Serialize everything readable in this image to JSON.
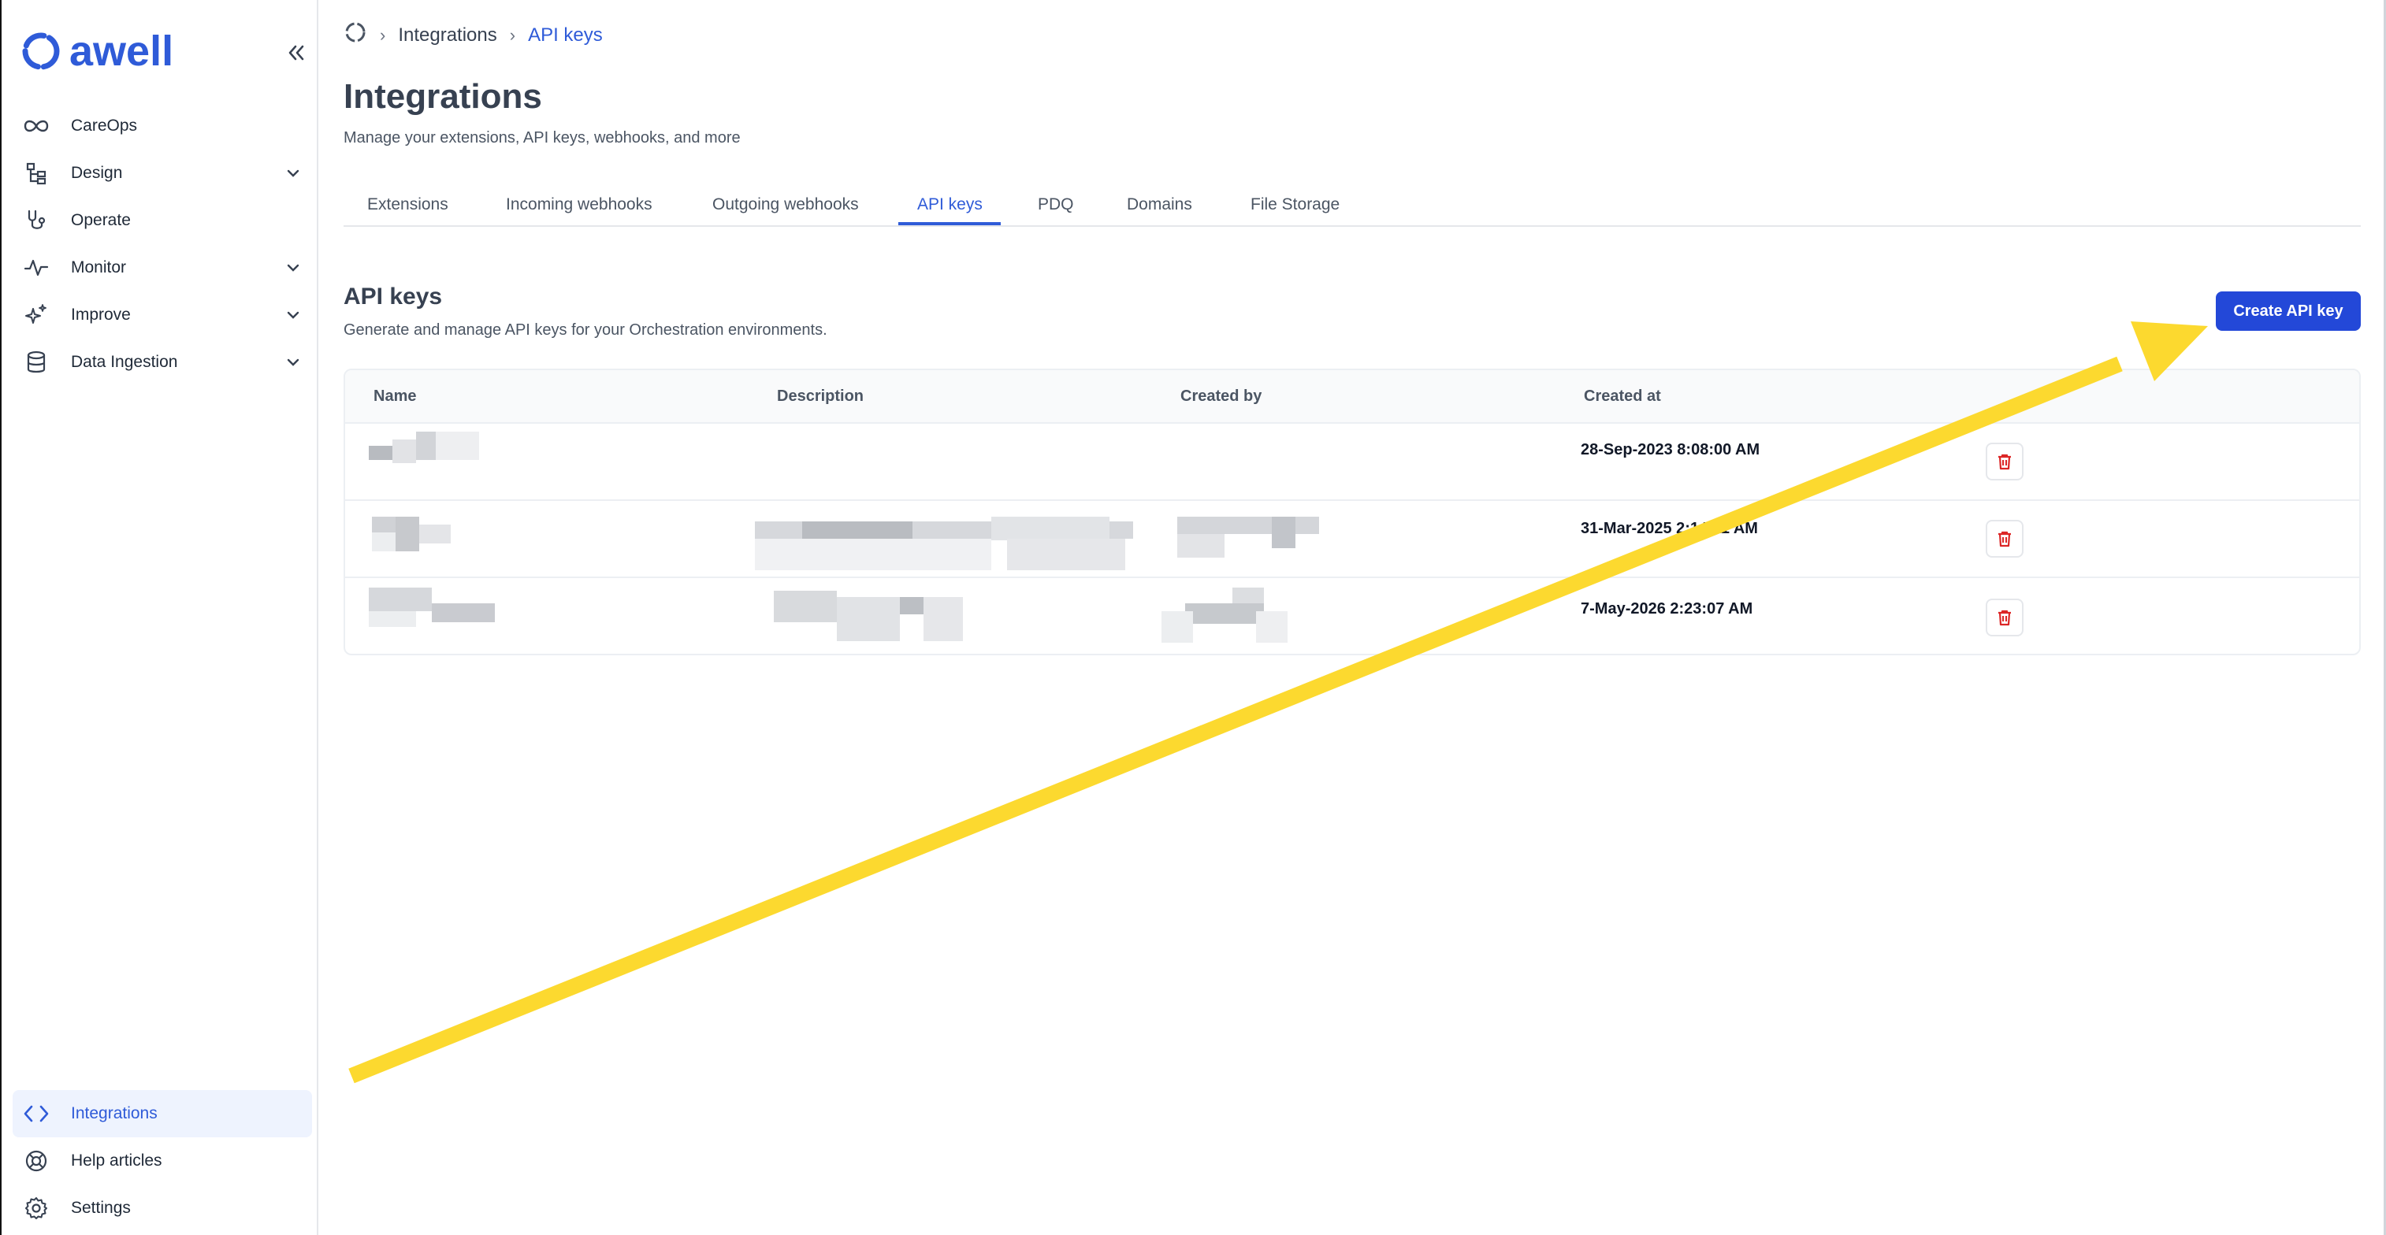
{
  "sidebar": {
    "logo_text": "awell",
    "items": [
      {
        "label": "CareOps",
        "icon": "infinity-icon"
      },
      {
        "label": "Design",
        "icon": "tree-structure-icon"
      },
      {
        "label": "Operate",
        "icon": "stethoscope-icon"
      },
      {
        "label": "Monitor",
        "icon": "activity-pulse-icon"
      },
      {
        "label": "Improve",
        "icon": "sparkles-icon"
      },
      {
        "label": "Data Ingestion",
        "icon": "database-icon"
      }
    ],
    "bottom_items": [
      {
        "label": "Integrations",
        "icon": "code-brackets-icon"
      },
      {
        "label": "Help articles",
        "icon": "lifebuoy-icon"
      },
      {
        "label": "Settings",
        "icon": "gear-icon"
      }
    ]
  },
  "breadcrumb": {
    "items": [
      "Integrations",
      "API keys"
    ]
  },
  "page": {
    "title": "Integrations",
    "subtitle": "Manage your extensions, API keys, webhooks, and more"
  },
  "tabs": [
    "Extensions",
    "Incoming webhooks",
    "Outgoing webhooks",
    "API keys",
    "PDQ",
    "Domains",
    "File Storage"
  ],
  "active_tab": "API keys",
  "section": {
    "title": "API keys",
    "subtitle": "Generate and manage API keys for your Orchestration environments.",
    "create_label": "Create API key"
  },
  "table": {
    "headers": [
      "Name",
      "Description",
      "Created by",
      "Created at"
    ],
    "rows": [
      {
        "created_at": "28-Sep-2023 8:08:00 AM"
      },
      {
        "created_at": "31-Mar-2025 2:14:11 AM"
      },
      {
        "created_at": "7-May-2026 2:23:07 AM"
      }
    ]
  },
  "colors": {
    "accent": "#2f5bd8",
    "button": "#2348d8",
    "annotation_arrow": "#fcd92f",
    "delete_icon": "#dc2626"
  }
}
